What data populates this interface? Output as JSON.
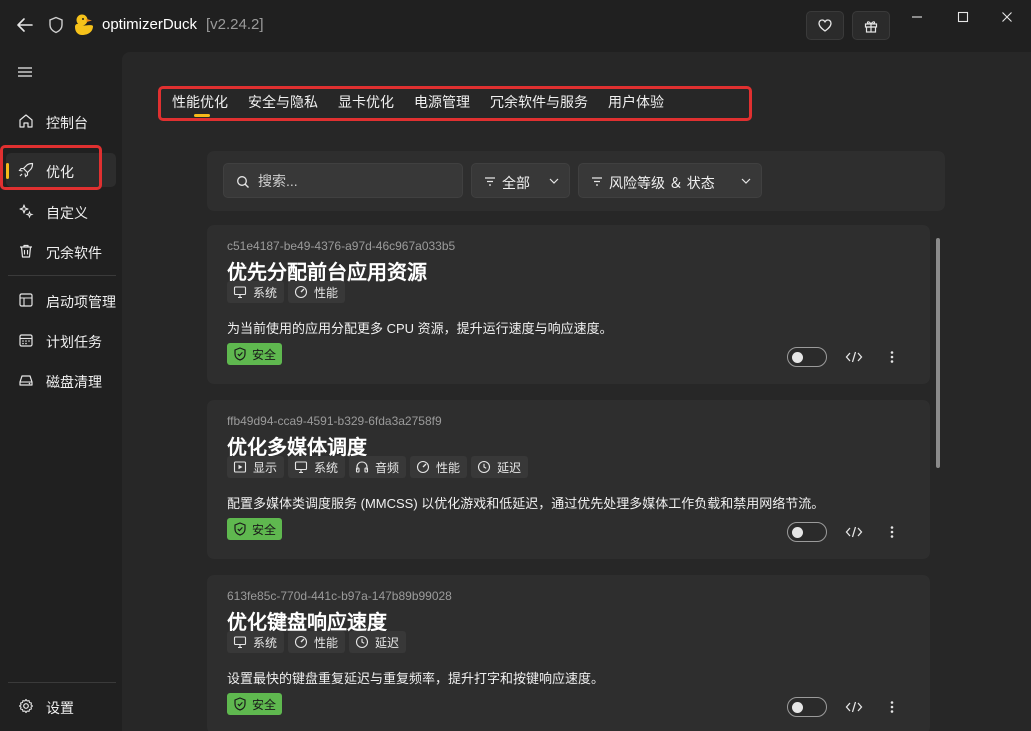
{
  "app": {
    "title": "optimizerDuck",
    "version": "[v2.24.2]"
  },
  "titlebar": {
    "back_icon": "arrow-left-icon",
    "heart_icon": "heart-icon",
    "gift_icon": "gift-icon"
  },
  "sidebar": {
    "items": [
      {
        "label": "控制台",
        "icon": "home-icon"
      },
      {
        "label": "优化",
        "icon": "rocket-icon",
        "active": true
      },
      {
        "label": "自定义",
        "icon": "sparkle-icon"
      },
      {
        "label": "冗余软件",
        "icon": "trash-icon"
      },
      {
        "label": "启动项管理",
        "icon": "startup-icon"
      },
      {
        "label": "计划任务",
        "icon": "calendar-icon"
      },
      {
        "label": "磁盘清理",
        "icon": "drive-icon"
      }
    ],
    "settings_label": "设置"
  },
  "tabs": [
    "性能优化",
    "安全与隐私",
    "显卡优化",
    "电源管理",
    "冗余软件与服务",
    "用户体验"
  ],
  "filters": {
    "search_placeholder": "搜索...",
    "category": "全部",
    "risk": "风险等级 ＆ 状态"
  },
  "cards": [
    {
      "id": "c51e4187-be49-4376-a97d-46c967a033b5",
      "title": "优先分配前台应用资源",
      "tags": [
        {
          "label": "系统",
          "icon": "monitor-icon"
        },
        {
          "label": "性能",
          "icon": "gauge-icon"
        }
      ],
      "description": "为当前使用的应用分配更多 CPU 资源，提升运行速度与响应速度。",
      "badge": "安全",
      "enabled": false
    },
    {
      "id": "ffb49d94-cca9-4591-b329-6fda3a2758f9",
      "title": "优化多媒体调度",
      "tags": [
        {
          "label": "显示",
          "icon": "play-icon"
        },
        {
          "label": "系统",
          "icon": "monitor-icon"
        },
        {
          "label": "音频",
          "icon": "headphones-icon"
        },
        {
          "label": "性能",
          "icon": "gauge-icon"
        },
        {
          "label": "延迟",
          "icon": "clock-icon"
        }
      ],
      "description": "配置多媒体类调度服务 (MMCSS) 以优化游戏和低延迟，通过优先处理多媒体工作负载和禁用网络节流。",
      "badge": "安全",
      "enabled": false
    },
    {
      "id": "613fe85c-770d-441c-b97a-147b89b99028",
      "title": "优化键盘响应速度",
      "tags": [
        {
          "label": "系统",
          "icon": "monitor-icon"
        },
        {
          "label": "性能",
          "icon": "gauge-icon"
        },
        {
          "label": "延迟",
          "icon": "clock-icon"
        }
      ],
      "description": "设置最快的键盘重复延迟与重复频率，提升打字和按键响应速度。",
      "badge": "安全",
      "enabled": false
    }
  ],
  "colors": {
    "accent": "#f6b91a",
    "safe_badge": "#5fb84f",
    "highlight_box": "#e03030"
  }
}
